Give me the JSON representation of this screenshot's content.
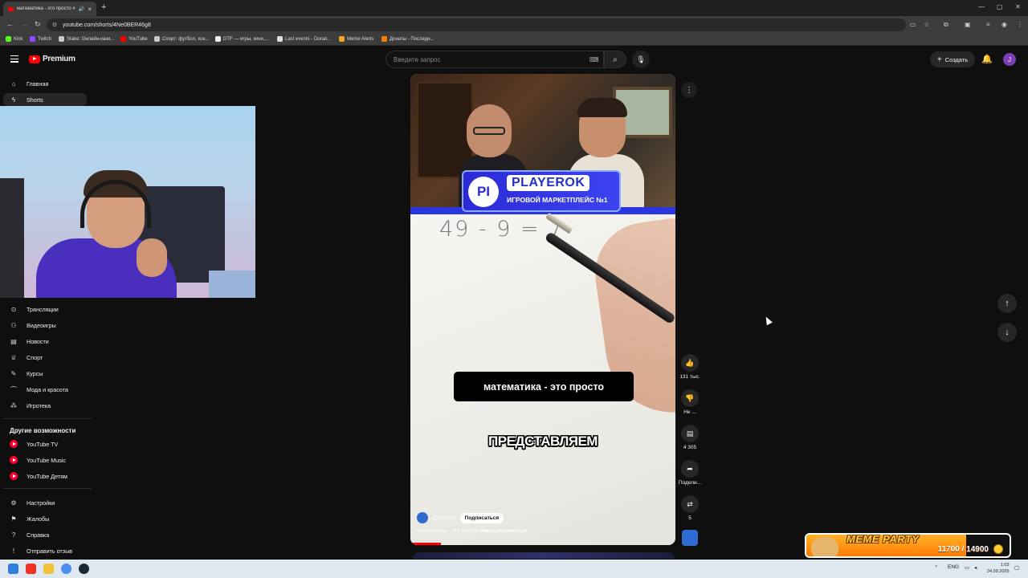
{
  "browser": {
    "tab_title": "математика - это просто #",
    "url": "youtube.com/shorts/4Ne0BER46g8",
    "bookmarks": [
      {
        "label": "Kick",
        "color": "#53fc18"
      },
      {
        "label": "Twitch",
        "color": "#9146ff"
      },
      {
        "label": "Stake: Онлайн-кази...",
        "color": "#1a2c38"
      },
      {
        "label": "YouTube",
        "color": "#ff0000"
      },
      {
        "label": "Спорт: футбол, хок...",
        "color": "#c8c8c8"
      },
      {
        "label": "DTF — игры, кино,...",
        "color": "#2a2a2a"
      },
      {
        "label": "Last events - Donat...",
        "color": "#333333"
      },
      {
        "label": "Meme Alerts",
        "color": "#f6a623"
      },
      {
        "label": "Донаты - Последн...",
        "color": "#f57d07"
      }
    ]
  },
  "header": {
    "brand": "Premium",
    "search_placeholder": "Введите запрос",
    "create_label": "Создать",
    "avatar_letter": "J"
  },
  "sidebar": {
    "top": [
      {
        "label": "Главная",
        "icon": "home-icon"
      },
      {
        "label": "Shorts",
        "icon": "shorts-icon",
        "active": true
      }
    ],
    "explore": [
      {
        "label": "Трансляции",
        "icon": "live-icon"
      },
      {
        "label": "Видеоигры",
        "icon": "gamepad-icon"
      },
      {
        "label": "Новости",
        "icon": "news-icon"
      },
      {
        "label": "Спорт",
        "icon": "trophy-icon"
      },
      {
        "label": "Курсы",
        "icon": "courses-icon"
      },
      {
        "label": "Мода и красота",
        "icon": "hanger-icon"
      },
      {
        "label": "Игротека",
        "icon": "playables-icon"
      }
    ],
    "more_heading": "Другие возможности",
    "more": [
      {
        "label": "YouTube TV"
      },
      {
        "label": "YouTube Music"
      },
      {
        "label": "YouTube Детям"
      }
    ],
    "bottom": [
      {
        "label": "Настройки",
        "icon": "gear-icon"
      },
      {
        "label": "Жалобы",
        "icon": "flag-icon"
      },
      {
        "label": "Справка",
        "icon": "help-icon"
      },
      {
        "label": "Отправить отзыв",
        "icon": "feedback-icon"
      }
    ]
  },
  "short": {
    "banner_badge": "PI",
    "banner_name": "PLAYEROK",
    "banner_sub": "ИГРОВОЙ МАРКЕТПЛЕЙС №1",
    "equation": "49 - 9 = 7",
    "caption": "математика - это просто",
    "overlay_text": "ПРЕДСТАВЛЯЕМ",
    "channel": "@narezw",
    "subscribe_label": "Подписаться",
    "title": "математика - это просто",
    "hashtag": "#нельзясмеяться",
    "progress_fraction": 0.115
  },
  "actions": {
    "likes": "131 тыс.",
    "dislike": "Не ...",
    "comments": "4 305",
    "share": "Подели...",
    "remix": "5"
  },
  "meme_party": {
    "title": "MEME PARTY",
    "count": "11700 / 14900",
    "progress_fraction": 0.785
  },
  "taskbar": {
    "lang": "ENG",
    "time": "1:03",
    "date": "24.09.2025"
  }
}
